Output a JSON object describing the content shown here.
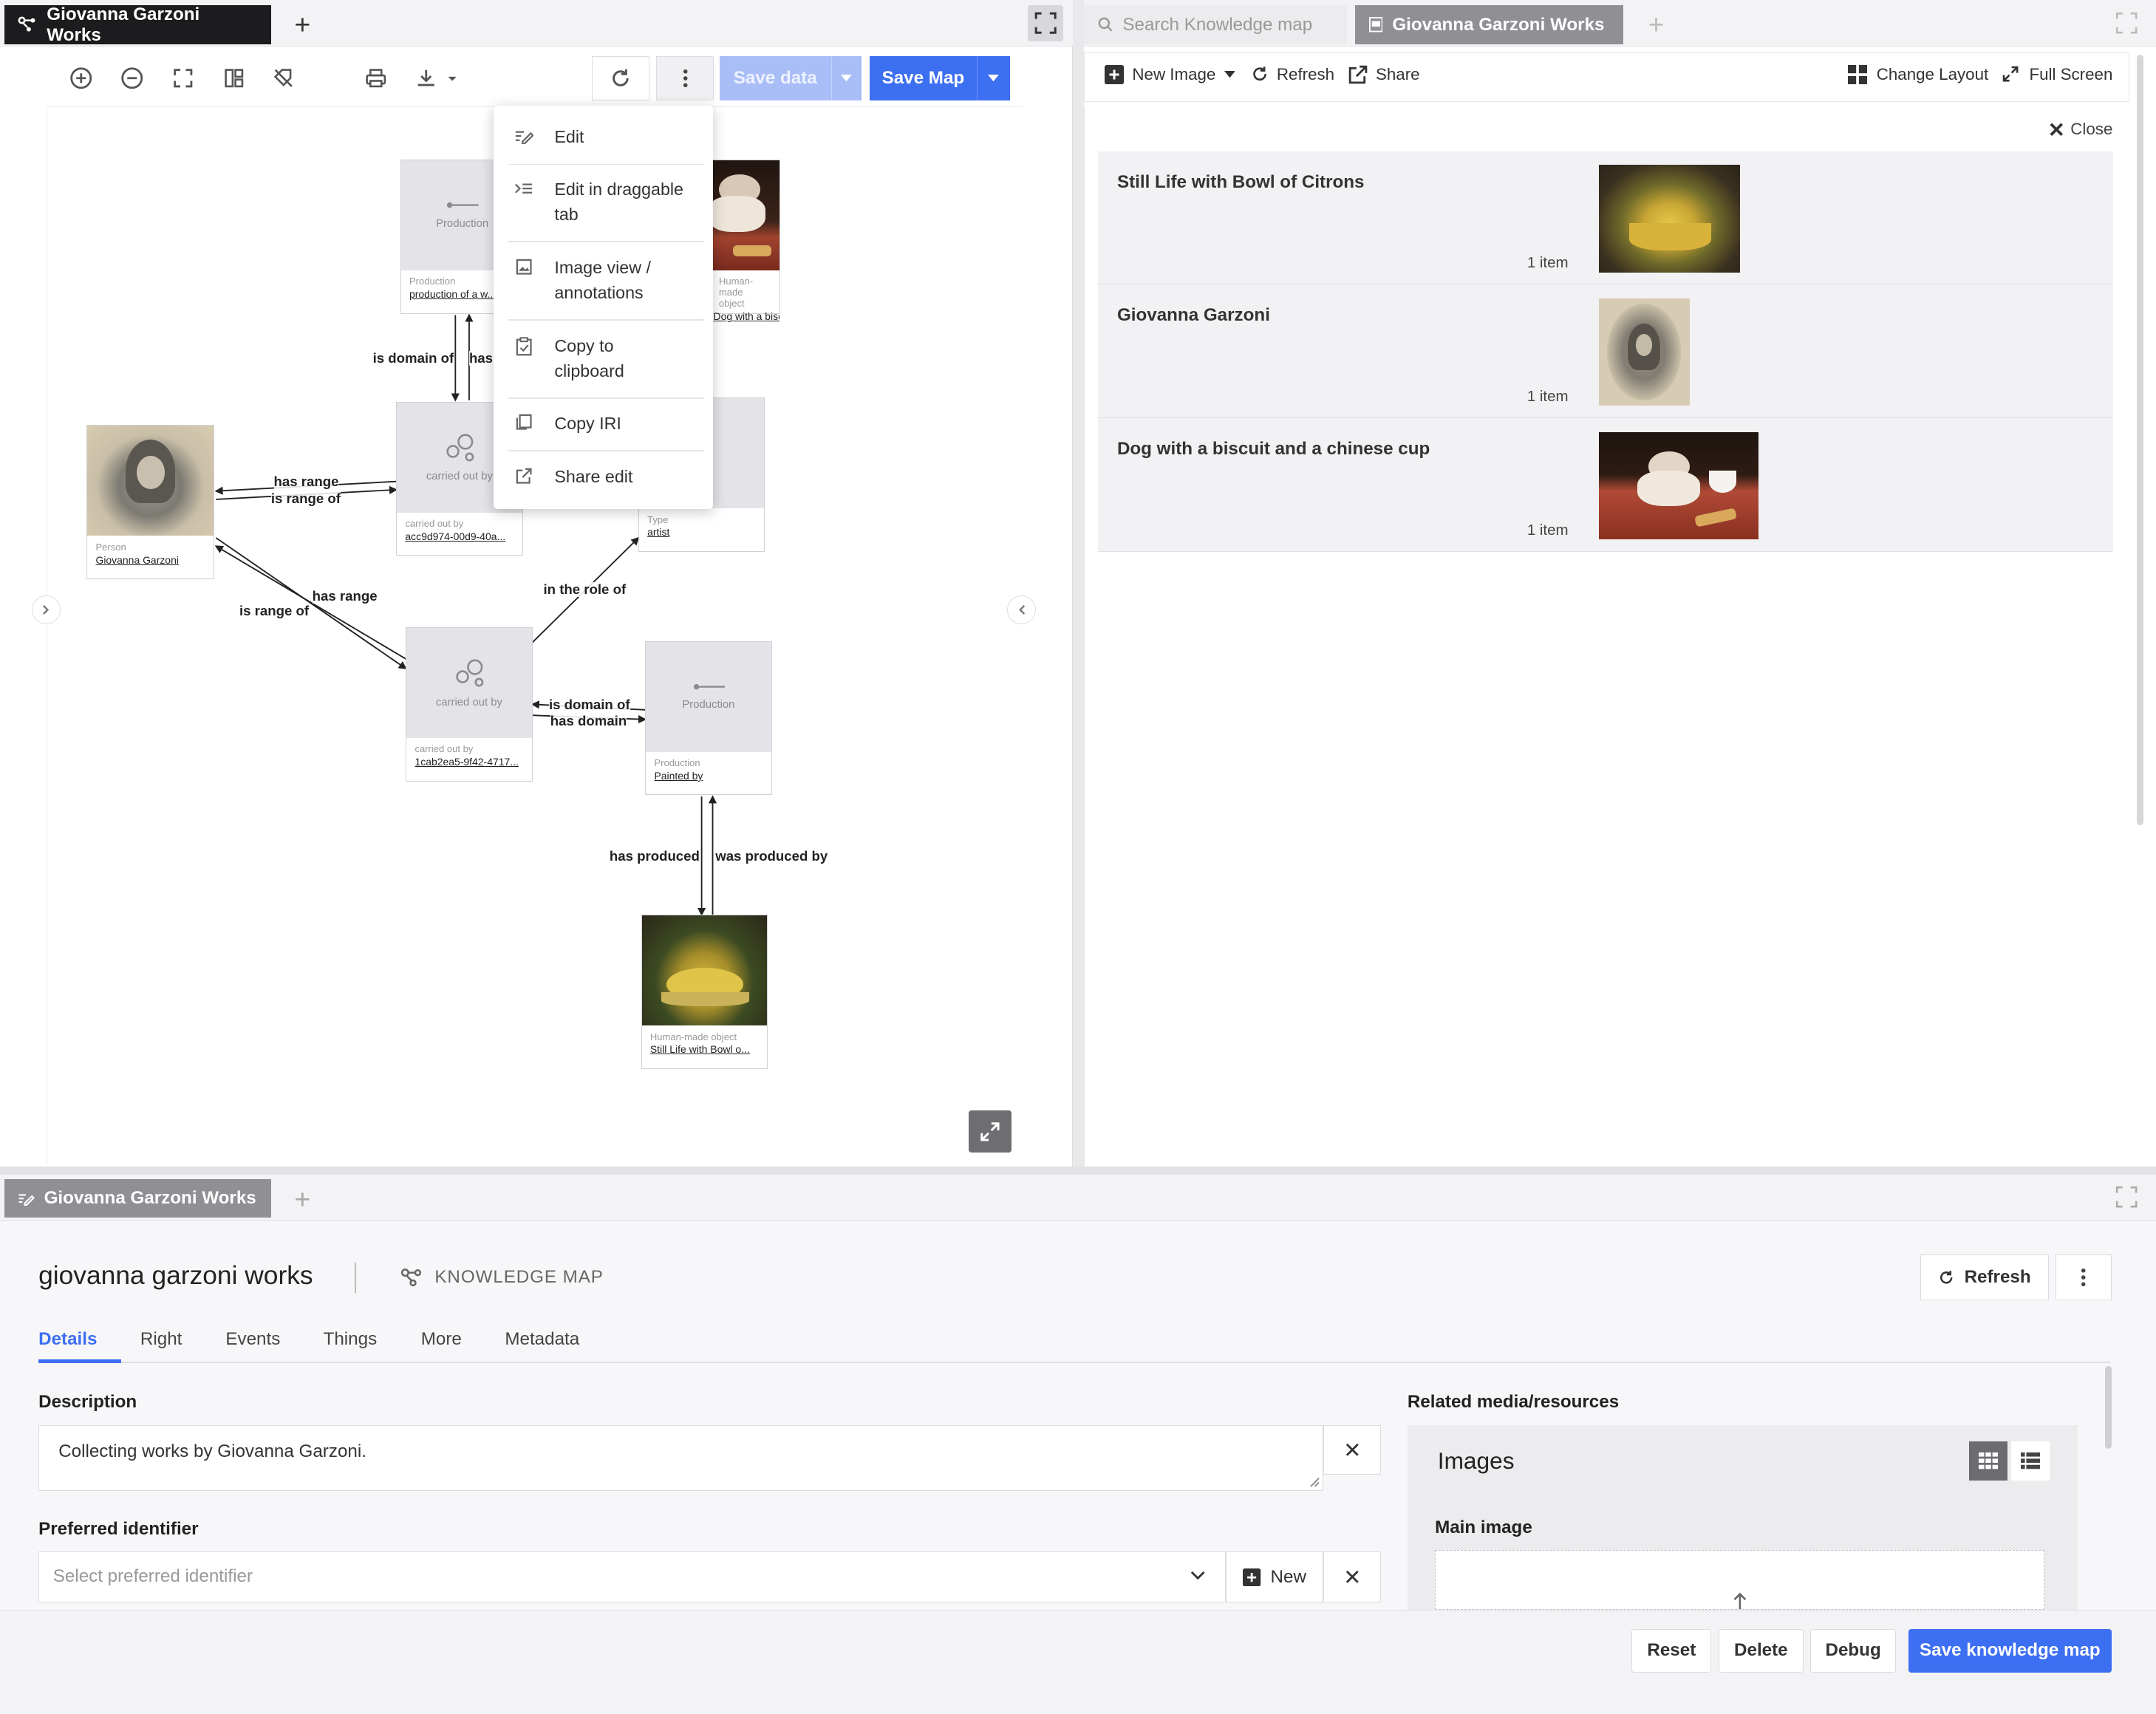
{
  "left_panel": {
    "tab_title": "Giovanna Garzoni Works",
    "toolbar": {
      "save_data": "Save data",
      "save_map": "Save Map"
    },
    "context_menu": [
      {
        "label": "Edit",
        "icon": "edit-icon"
      },
      {
        "label": "Edit in draggable tab",
        "icon": "indent-icon"
      },
      {
        "label": "Image view / annotations",
        "icon": "image-icon"
      },
      {
        "label": "Copy to clipboard",
        "icon": "clipboard-icon"
      },
      {
        "label": "Copy IRI",
        "icon": "copy-icon"
      },
      {
        "label": "Share edit",
        "icon": "share-icon"
      }
    ],
    "nodes": {
      "production_top": {
        "top": "Production",
        "class": "Production",
        "link": "production of a w..."
      },
      "dog_object": {
        "class": "Human-made object",
        "link": "Dog with a biscuit a..."
      },
      "person": {
        "class": "Person",
        "link": "Giovanna Garzoni"
      },
      "carried_1": {
        "top": "carried out by",
        "class": "carried out by",
        "link": "acc9d974-00d9-40a..."
      },
      "type": {
        "class": "Type",
        "link": "artist"
      },
      "carried_2": {
        "top": "carried out by",
        "class": "carried out by",
        "link": "1cab2ea5-9f42-4717..."
      },
      "production_2": {
        "top": "Production",
        "class": "Production",
        "link": "Painted by"
      },
      "still_life": {
        "class": "Human-made object",
        "link": "Still Life with Bowl o..."
      }
    },
    "edges": {
      "is_domain_of_1": "is domain of",
      "has_1": "has",
      "has_range_1": "has range",
      "is_range_of_1": "is range of",
      "has_range_2": "has range",
      "is_range_of_2": "is range of",
      "in_the_role_of": "in the role of",
      "is_domain_of_2": "is domain of",
      "has_domain": "has domain",
      "has_produced": "has produced",
      "was_produced_by": "was produced by"
    }
  },
  "right_panel": {
    "search_tab": "Search Knowledge map",
    "active_tab": "Giovanna Garzoni Works",
    "toolbar": {
      "new_image": "New Image",
      "refresh": "Refresh",
      "share": "Share",
      "change_layout": "Change Layout",
      "full_screen": "Full Screen"
    },
    "close": "Close",
    "rows": [
      {
        "title": "Still Life with Bowl of Citrons",
        "count": "1 item"
      },
      {
        "title": "Giovanna Garzoni",
        "count": "1 item"
      },
      {
        "title": "Dog with a biscuit and a chinese cup",
        "count": "1 item"
      }
    ]
  },
  "bottom_panel": {
    "tab_title": "Giovanna Garzoni Works",
    "title": "giovanna garzoni works",
    "type_label": "KNOWLEDGE MAP",
    "refresh": "Refresh",
    "tabs": [
      "Details",
      "Right",
      "Events",
      "Things",
      "More",
      "Metadata"
    ],
    "description_label": "Description",
    "description_value": "Collecting works by Giovanna Garzoni.",
    "preferred_identifier_label": "Preferred identifier",
    "preferred_identifier_placeholder": "Select preferred identifier",
    "new_label": "New",
    "related_label": "Related media/resources",
    "images_label": "Images",
    "main_image_label": "Main image",
    "buttons": {
      "reset": "Reset",
      "delete": "Delete",
      "debug": "Debug",
      "save": "Save knowledge map"
    }
  },
  "colors": {
    "accent": "#3d6ff2",
    "dark_tab": "#1c1c1e"
  }
}
